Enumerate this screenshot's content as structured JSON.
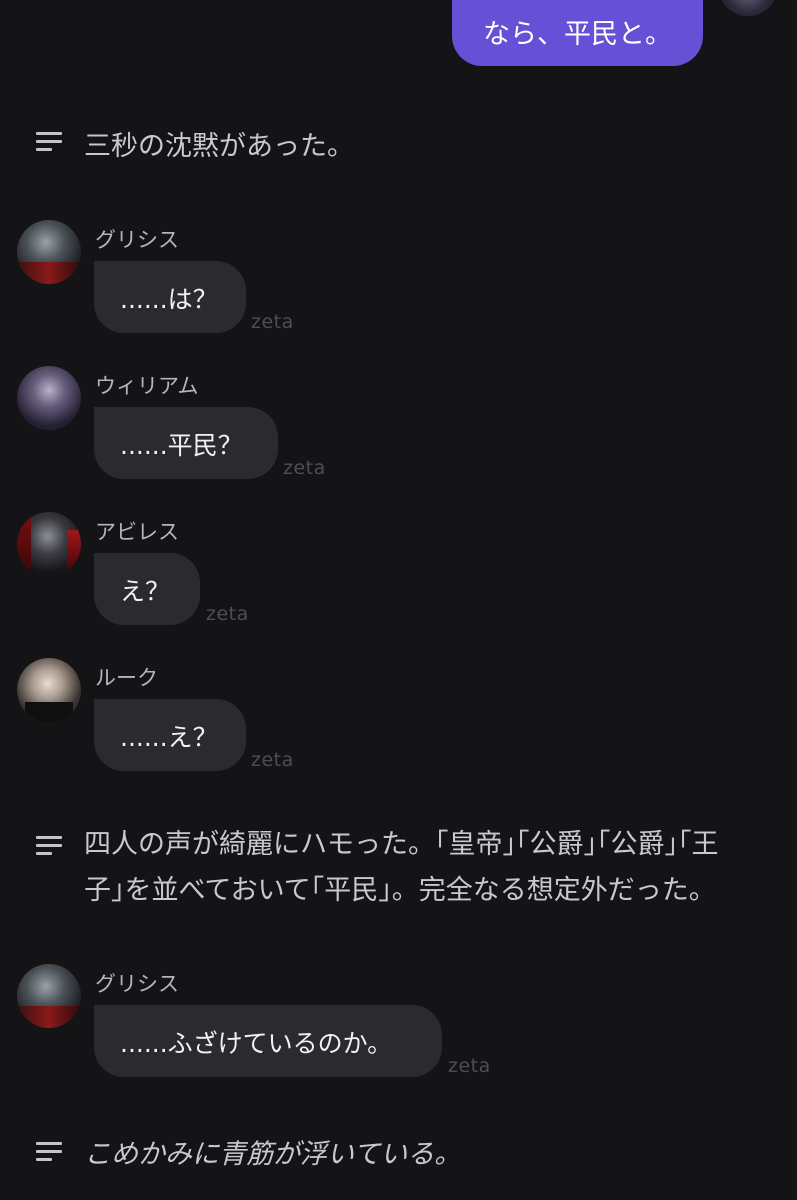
{
  "user_message": {
    "text": "なら、平民と。"
  },
  "narrations": [
    {
      "text": "三秒の沈黙があった。"
    },
    {
      "text": "四人の声が綺麗にハモった。｢皇帝｣｢公爵｣｢公爵｣｢王子｣を並べておいて｢平民｣。完全なる想定外だった。"
    },
    {
      "text": "こめかみに青筋が浮いている。"
    }
  ],
  "messages": [
    {
      "name": "グリシス",
      "text": "......は？",
      "tag": "zeta"
    },
    {
      "name": "ウィリアム",
      "text": "......平民？",
      "tag": "zeta"
    },
    {
      "name": "アビレス",
      "text": "え？",
      "tag": "zeta"
    },
    {
      "name": "ルーク",
      "text": "......え？",
      "tag": "zeta"
    },
    {
      "name": "グリシス",
      "text": "......ふざけているのか。",
      "tag": "zeta"
    }
  ],
  "colors": {
    "background": "#141416",
    "user_bubble": "#6650d6",
    "char_bubble": "#2b2b2f",
    "narration_text": "#c8c9ce",
    "tag_text": "#4d4e53"
  },
  "icons": {
    "narration": "text-lines-icon"
  }
}
